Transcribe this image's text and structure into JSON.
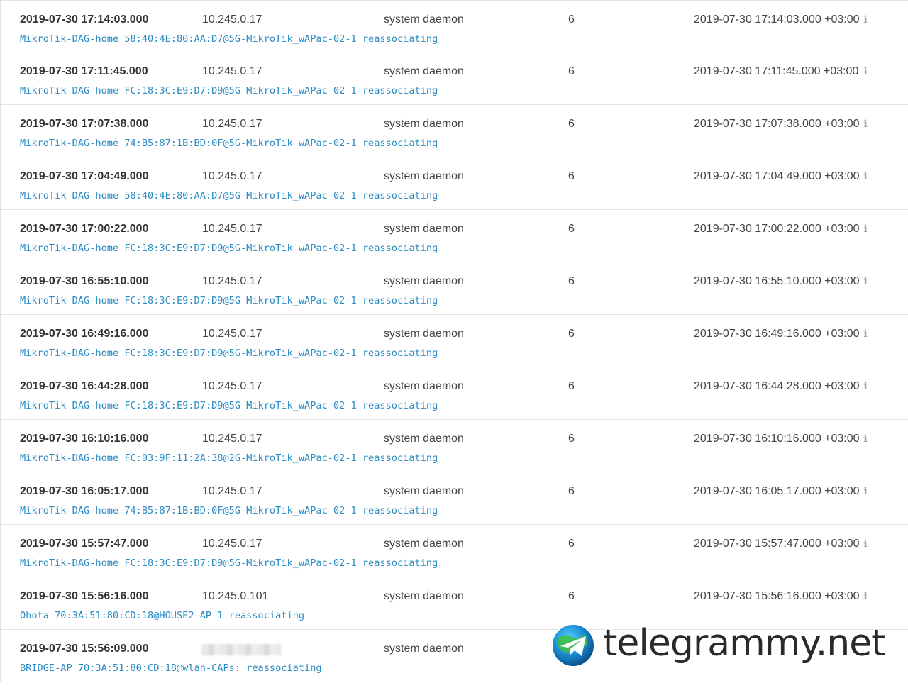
{
  "colors": {
    "message": "#2b8cc4",
    "timestamp": "#333333",
    "text": "#444444",
    "divider": "#e2e2e2",
    "info_icon": "#9aa0a6"
  },
  "info_icon": "info-icon",
  "rows": [
    {
      "timestamp": "2019-07-30 17:14:03.000",
      "source": "10.245.0.17",
      "facility": "system daemon",
      "level": "6",
      "received": "2019-07-30 17:14:03.000 +03:00",
      "message": "MikroTik-DAG-home 58:40:4E:80:AA:D7@5G-MikroTik_wAPac-02-1 reassociating"
    },
    {
      "timestamp": "2019-07-30 17:11:45.000",
      "source": "10.245.0.17",
      "facility": "system daemon",
      "level": "6",
      "received": "2019-07-30 17:11:45.000 +03:00",
      "message": "MikroTik-DAG-home FC:18:3C:E9:D7:D9@5G-MikroTik_wAPac-02-1 reassociating"
    },
    {
      "timestamp": "2019-07-30 17:07:38.000",
      "source": "10.245.0.17",
      "facility": "system daemon",
      "level": "6",
      "received": "2019-07-30 17:07:38.000 +03:00",
      "message": "MikroTik-DAG-home 74:B5:87:1B:BD:0F@5G-MikroTik_wAPac-02-1 reassociating"
    },
    {
      "timestamp": "2019-07-30 17:04:49.000",
      "source": "10.245.0.17",
      "facility": "system daemon",
      "level": "6",
      "received": "2019-07-30 17:04:49.000 +03:00",
      "message": "MikroTik-DAG-home 58:40:4E:80:AA:D7@5G-MikroTik_wAPac-02-1 reassociating"
    },
    {
      "timestamp": "2019-07-30 17:00:22.000",
      "source": "10.245.0.17",
      "facility": "system daemon",
      "level": "6",
      "received": "2019-07-30 17:00:22.000 +03:00",
      "message": "MikroTik-DAG-home FC:18:3C:E9:D7:D9@5G-MikroTik_wAPac-02-1 reassociating"
    },
    {
      "timestamp": "2019-07-30 16:55:10.000",
      "source": "10.245.0.17",
      "facility": "system daemon",
      "level": "6",
      "received": "2019-07-30 16:55:10.000 +03:00",
      "message": "MikroTik-DAG-home FC:18:3C:E9:D7:D9@5G-MikroTik_wAPac-02-1 reassociating"
    },
    {
      "timestamp": "2019-07-30 16:49:16.000",
      "source": "10.245.0.17",
      "facility": "system daemon",
      "level": "6",
      "received": "2019-07-30 16:49:16.000 +03:00",
      "message": "MikroTik-DAG-home FC:18:3C:E9:D7:D9@5G-MikroTik_wAPac-02-1 reassociating"
    },
    {
      "timestamp": "2019-07-30 16:44:28.000",
      "source": "10.245.0.17",
      "facility": "system daemon",
      "level": "6",
      "received": "2019-07-30 16:44:28.000 +03:00",
      "message": "MikroTik-DAG-home FC:18:3C:E9:D7:D9@5G-MikroTik_wAPac-02-1 reassociating"
    },
    {
      "timestamp": "2019-07-30 16:10:16.000",
      "source": "10.245.0.17",
      "facility": "system daemon",
      "level": "6",
      "received": "2019-07-30 16:10:16.000 +03:00",
      "message": "MikroTik-DAG-home FC:03:9F:11:2A:38@2G-MikroTik_wAPac-02-1 reassociating"
    },
    {
      "timestamp": "2019-07-30 16:05:17.000",
      "source": "10.245.0.17",
      "facility": "system daemon",
      "level": "6",
      "received": "2019-07-30 16:05:17.000 +03:00",
      "message": "MikroTik-DAG-home 74:B5:87:1B:BD:0F@5G-MikroTik_wAPac-02-1 reassociating"
    },
    {
      "timestamp": "2019-07-30 15:57:47.000",
      "source": "10.245.0.17",
      "facility": "system daemon",
      "level": "6",
      "received": "2019-07-30 15:57:47.000 +03:00",
      "message": "MikroTik-DAG-home FC:18:3C:E9:D7:D9@5G-MikroTik_wAPac-02-1 reassociating"
    },
    {
      "timestamp": "2019-07-30 15:56:16.000",
      "source": "10.245.0.101",
      "facility": "system daemon",
      "level": "6",
      "received": "2019-07-30 15:56:16.000 +03:00",
      "message": "Ohota 70:3A:51:80:CD:18@HOUSE2-AP-1 reassociating"
    },
    {
      "timestamp": "2019-07-30 15:56:09.000",
      "source": "",
      "facility": "system daemon",
      "level": "",
      "received": "",
      "message": "BRIDGE-AP 70:3A:51:80:CD:18@wlan-CAPs: reassociating"
    }
  ],
  "watermark": {
    "text": "telegrammy.net",
    "logo_icon": "telegram-globe-icon"
  }
}
